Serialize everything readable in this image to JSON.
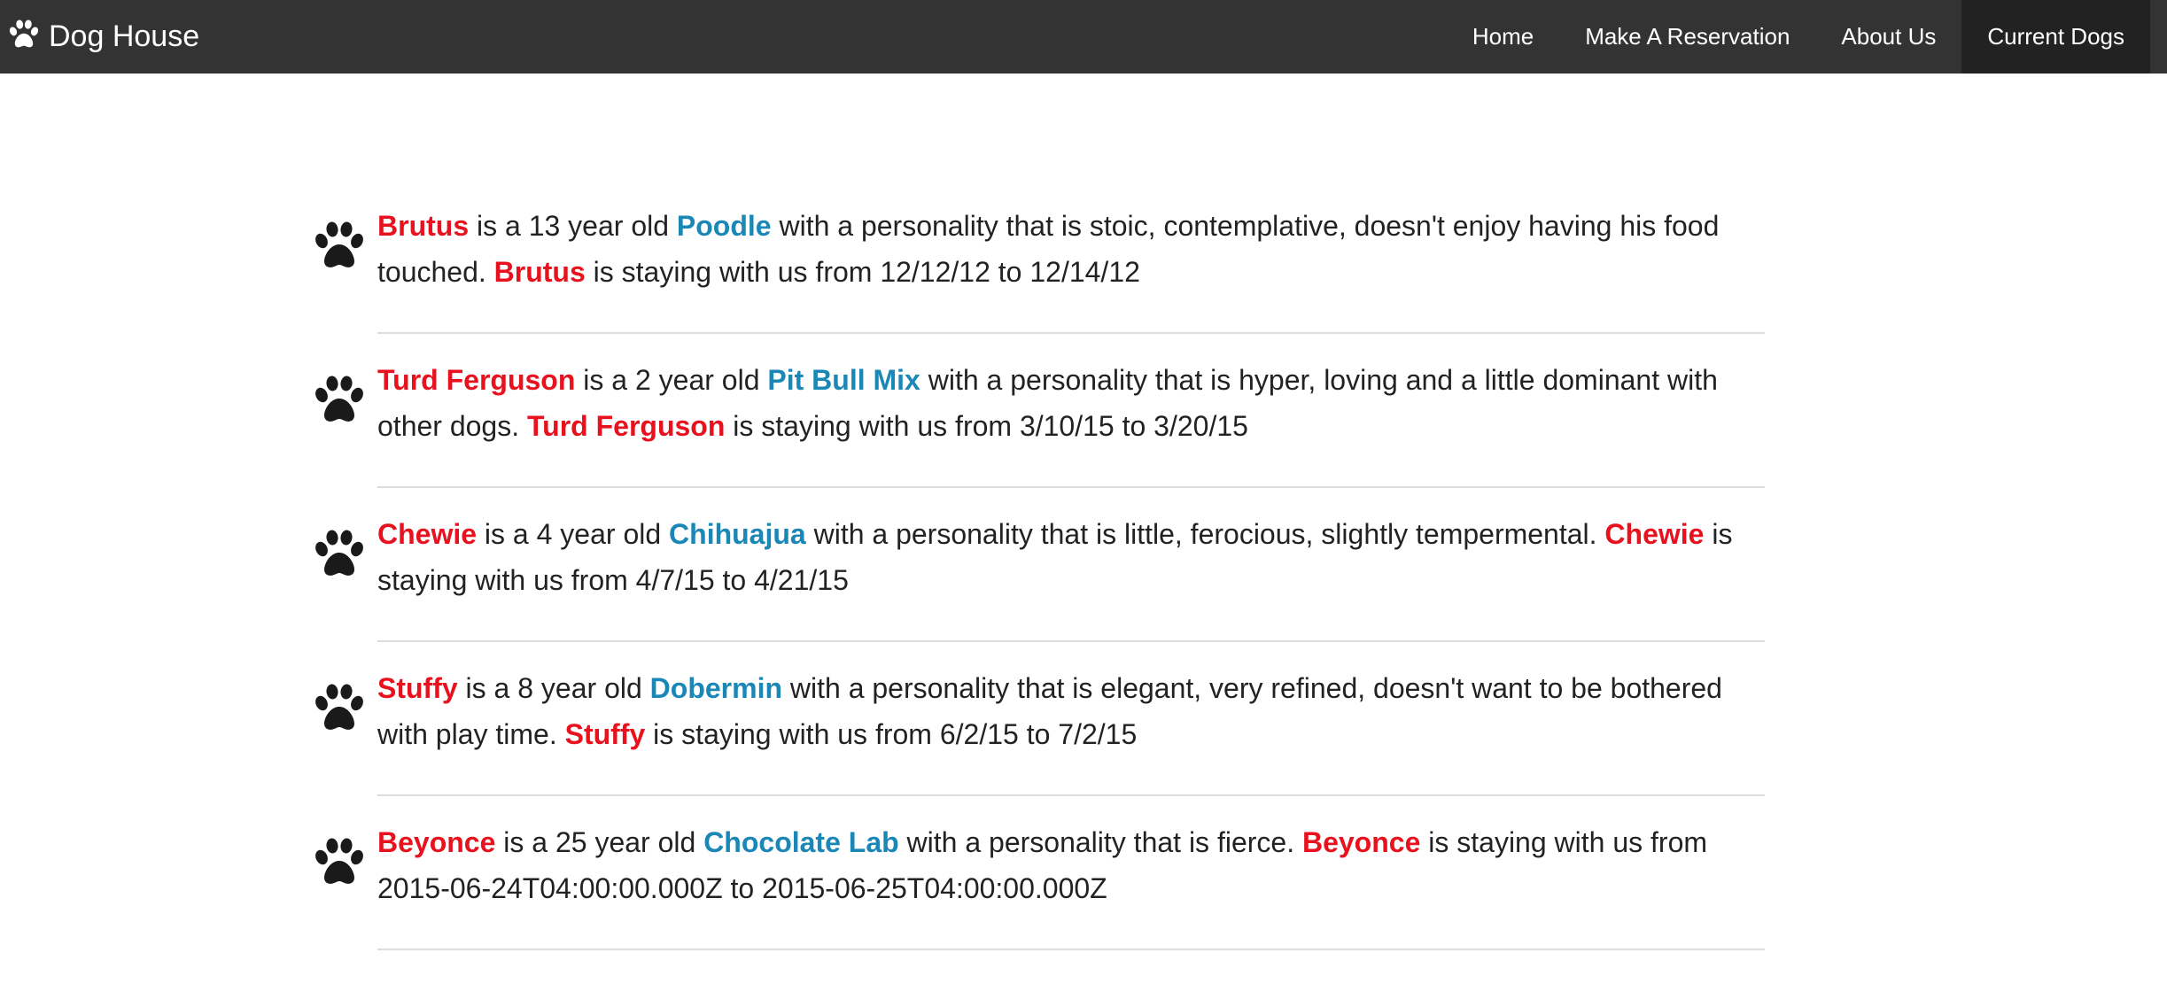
{
  "navbar": {
    "brand": "Dog House",
    "brand_icon": "paw-icon",
    "links": [
      {
        "label": "Home",
        "active": false
      },
      {
        "label": "Make A Reservation",
        "active": false
      },
      {
        "label": "About Us",
        "active": false
      },
      {
        "label": "Current Dogs",
        "active": true
      }
    ]
  },
  "colors": {
    "navbar_bg": "#333333",
    "active_bg": "#222222",
    "name": "#e8121e",
    "breed": "#1a87b6"
  },
  "dogs": [
    {
      "name": "Brutus",
      "age": "13",
      "breed": "Poodle",
      "personality": "stoic, contemplative, doesn't enjoy having his food touched.",
      "from": "12/12/12",
      "to": "12/14/12"
    },
    {
      "name": "Turd Ferguson",
      "age": "2",
      "breed": "Pit Bull Mix",
      "personality": "hyper, loving and a little dominant with other dogs.",
      "from": "3/10/15",
      "to": "3/20/15"
    },
    {
      "name": "Chewie",
      "age": "4",
      "breed": "Chihuajua",
      "personality": "little, ferocious, slightly tempermental.",
      "from": "4/7/15",
      "to": "4/21/15"
    },
    {
      "name": "Stuffy",
      "age": "8",
      "breed": "Dobermin",
      "personality": "elegant, very refined, doesn't want to be bothered with play time.",
      "from": "6/2/15",
      "to": "7/2/15"
    },
    {
      "name": "Beyonce",
      "age": "25",
      "breed": "Chocolate Lab",
      "personality": "fierce.",
      "from": "2015-06-24T04:00:00.000Z",
      "to": "2015-06-25T04:00:00.000Z"
    }
  ]
}
